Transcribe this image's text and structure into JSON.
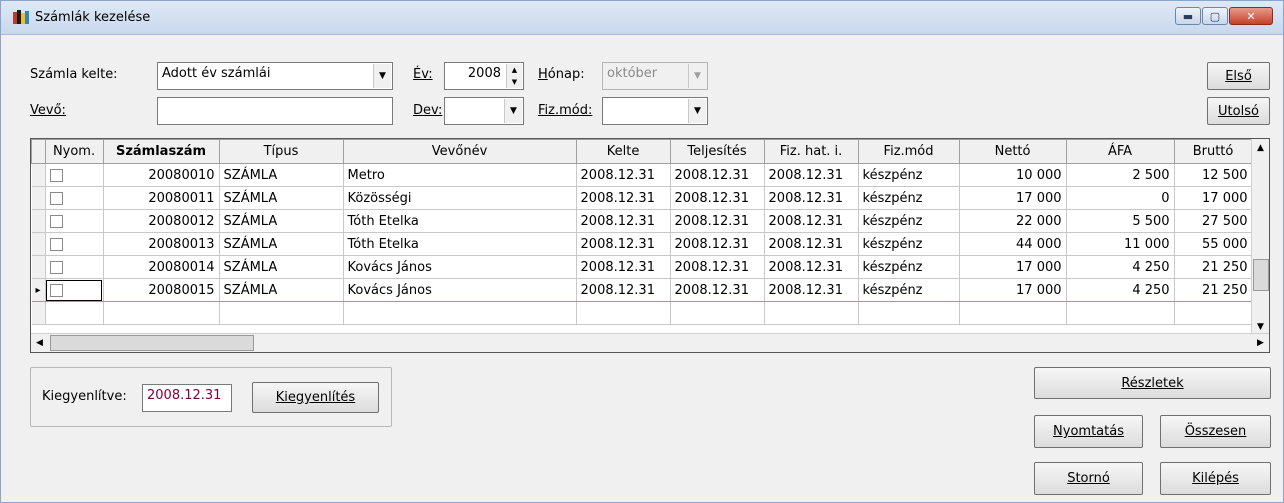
{
  "window": {
    "title": "Számlák kezelése",
    "title_icon": "books-icon",
    "buttons": [
      "minimize-icon",
      "maximize-icon",
      "close-icon"
    ]
  },
  "filters": {
    "szamla_kelte_label": "Számla kelte:",
    "szamla_kelte_value": "Adott év számlái",
    "ev_label": "Év:",
    "ev_value": "2008",
    "honap_label": "Hónap:",
    "honap_value": "október",
    "vevo_label": "Vevő:",
    "vevo_value": "",
    "dev_label": "Dev:",
    "dev_value": "",
    "fizmod_label": "Fiz.mód:",
    "fizmod_value": ""
  },
  "nav": {
    "first": "Első",
    "last": "Utolsó"
  },
  "grid": {
    "columns": [
      "Nyom.",
      "Számlaszám",
      "Típus",
      "Vevőnév",
      "Kelte",
      "Teljesítés",
      "Fiz. hat. i.",
      "Fiz.mód",
      "Nettó",
      "ÁFA",
      "Bruttó"
    ],
    "rows": [
      [
        "",
        "20080010",
        "SZÁMLA",
        "Metro",
        "2008.12.31",
        "2008.12.31",
        "2008.12.31",
        "készpénz",
        "10 000",
        "2 500",
        "12 500"
      ],
      [
        "",
        "20080011",
        "SZÁMLA",
        "Közösségi",
        "2008.12.31",
        "2008.12.31",
        "2008.12.31",
        "készpénz",
        "17 000",
        "0",
        "17 000"
      ],
      [
        "",
        "20080012",
        "SZÁMLA",
        "Tóth Etelka",
        "2008.12.31",
        "2008.12.31",
        "2008.12.31",
        "készpénz",
        "22 000",
        "5 500",
        "27 500"
      ],
      [
        "",
        "20080013",
        "SZÁMLA",
        "Tóth Etelka",
        "2008.12.31",
        "2008.12.31",
        "2008.12.31",
        "készpénz",
        "44 000",
        "11 000",
        "55 000"
      ],
      [
        "",
        "20080014",
        "SZÁMLA",
        "Kovács János",
        "2008.12.31",
        "2008.12.31",
        "2008.12.31",
        "készpénz",
        "17 000",
        "4 250",
        "21 250"
      ],
      [
        "",
        "20080015",
        "SZÁMLA",
        "Kovács János",
        "2008.12.31",
        "2008.12.31",
        "2008.12.31",
        "készpénz",
        "17 000",
        "4 250",
        "21 250"
      ]
    ]
  },
  "settle": {
    "label": "Kiegyenlítve:",
    "date": "2008.12.31",
    "button": "Kiegyenlítés",
    "date_color": "#800040"
  },
  "actions": {
    "details": "Részletek",
    "print": "Nyomtatás",
    "summary": "Összesen",
    "storno": "Stornó",
    "exit": "Kilépés"
  }
}
